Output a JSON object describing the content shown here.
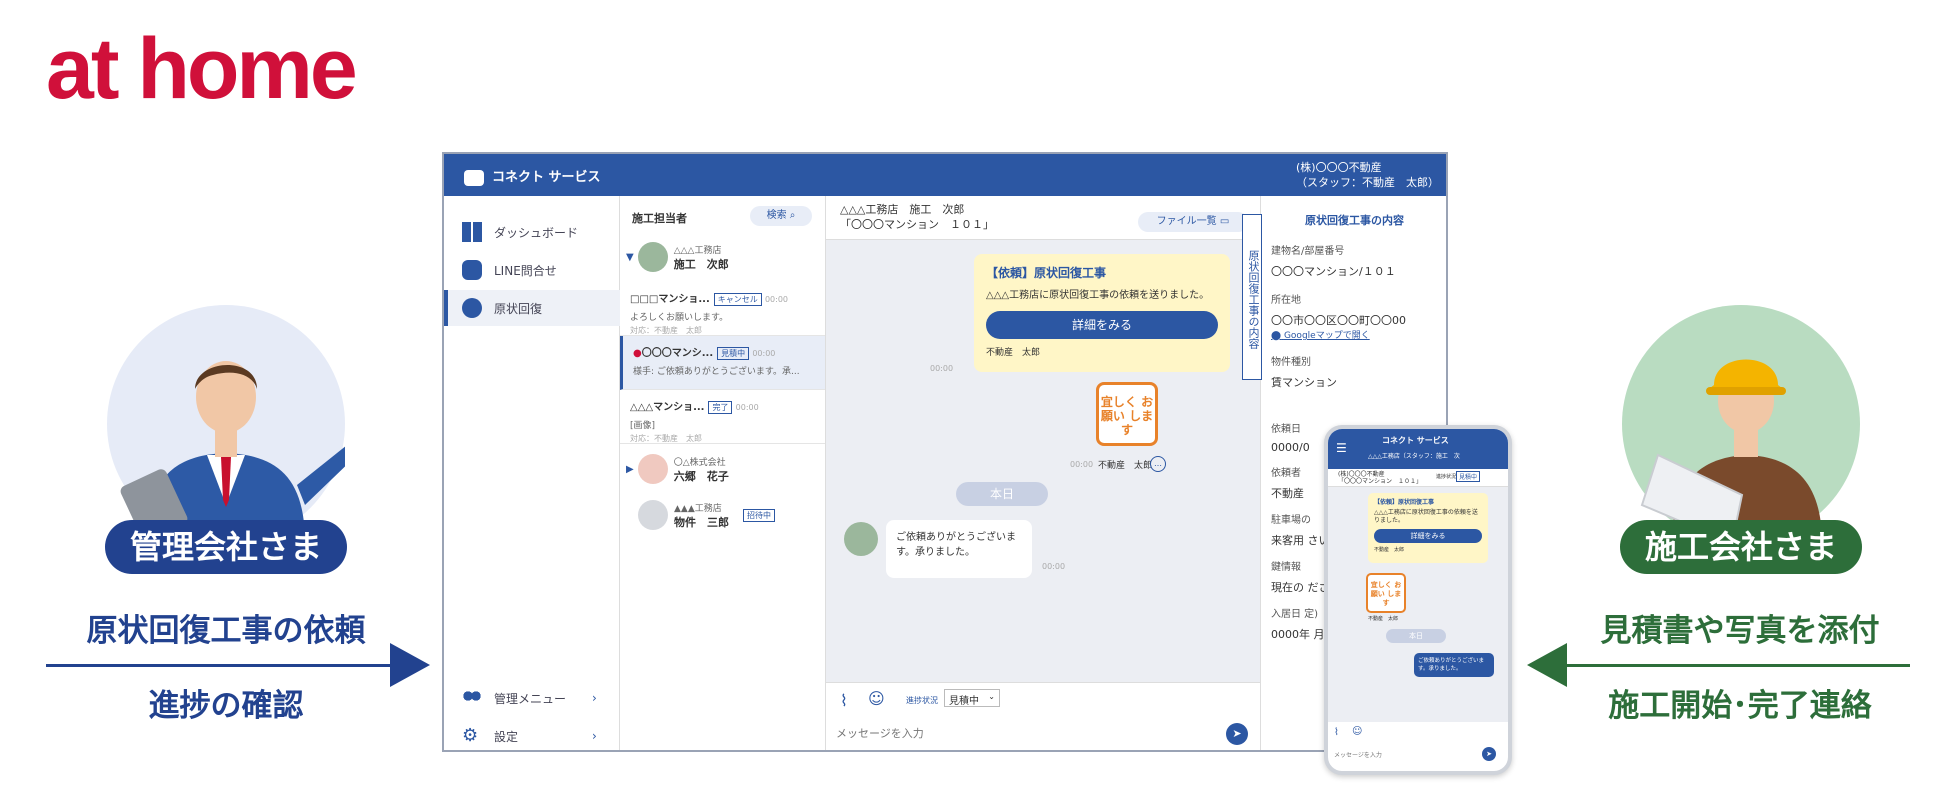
{
  "logo": {
    "text": "at home"
  },
  "left": {
    "badge": "管理会社さま",
    "caption1": "原状回復工事の依頼",
    "caption2": "進捗の確認"
  },
  "right": {
    "badge": "施工会社さま",
    "caption1": "見積書や写真を添付",
    "caption2": "施工開始･完了連絡"
  },
  "colors": {
    "brand": "#d0103a",
    "primary": "#2c57a3",
    "manager": "#22428f",
    "contractor": "#2d6e3a",
    "stamp": "#e8822a"
  },
  "app": {
    "title": "コネクト サービス",
    "user_line1": "(株)〇〇〇不動産",
    "user_line2": "（スタッフ：不動産　太郎）",
    "sidebar": {
      "items": [
        {
          "label": "ダッシュボード",
          "icon": "dashboard-icon"
        },
        {
          "label": "LINE問合せ",
          "icon": "chat-icon"
        },
        {
          "label": "原状回復",
          "icon": "restoration-icon"
        }
      ],
      "bottom": [
        {
          "label": "管理メニュー",
          "icon": "users-icon"
        },
        {
          "label": "設定",
          "icon": "gear-icon"
        }
      ]
    },
    "list": {
      "header": "施工担当者",
      "search_label": "検索",
      "groups": [
        {
          "company": "△△△工務店",
          "name": "施工　次郎"
        },
        {
          "company": "〇△株式会社",
          "name": "六郷　花子"
        },
        {
          "company": "▲▲▲工務店",
          "name": "物件　三郎",
          "badge": "招待中"
        }
      ],
      "conversations": [
        {
          "title": "□□□マンショ...",
          "badge": "キャンセル",
          "time": "00:00",
          "preview": "よろしくお願いします。",
          "meta": "対応：不動産　太郎"
        },
        {
          "title": "〇〇〇マンシ...",
          "badge": "見積中",
          "time": "00:00",
          "preview": "様手: ご依頼ありがとうございます。承...",
          "meta": ""
        },
        {
          "title": "△△△マンショ...",
          "badge": "完了",
          "time": "00:00",
          "preview": "[画像]",
          "meta": "対応：不動産　太郎"
        }
      ]
    },
    "chat": {
      "header_line1": "△△△工務店　施工　次郎",
      "header_line2": "「〇〇〇マンション　１０１」",
      "file_list_label": "ファイル一覧",
      "request_title": "【依頼】原状回復工事",
      "request_body": "△△△工務店に原状回復工事の依頼を送りました。",
      "detail_button": "詳細をみる",
      "request_sender": "不動産　太郎",
      "time": "00:00",
      "stamp_text": "宜しく お願い します",
      "stamp_sender": "不動産　太郎",
      "today_label": "本日",
      "reply_text": "ご依頼ありがとうございます。承りました。",
      "progress_label": "進捗状況",
      "progress_value": "見積中",
      "message_placeholder": "メッセージを入力"
    },
    "detail": {
      "tab_label": "原状回復工事の内容",
      "title": "原状回復工事の内容",
      "fields": [
        {
          "label": "建物名/部屋番号",
          "value": "〇〇〇マンション/１０１"
        },
        {
          "label": "所在地",
          "value": "〇〇市〇〇区〇〇町〇〇00"
        },
        {
          "label": "物件種別",
          "value": "賃マンション"
        },
        {
          "label": "依頼日",
          "value": "0000/0"
        },
        {
          "label": "依頼者",
          "value": "不動産"
        },
        {
          "label": "駐車場の",
          "value": "来客用 さい。"
        },
        {
          "label": "鍵情報",
          "value": "現在の ださい"
        },
        {
          "label": "入居日 定)",
          "value": "0000年 月00日 （入居"
        }
      ],
      "map_link": "Googleマップで開く"
    }
  },
  "phone": {
    "title": "コネクト サービス",
    "subtitle": "△△△工務店（スタッフ：施工　次",
    "chat_header1": "(株)〇〇〇不動産",
    "chat_header2": "「〇〇〇マンション　１０１」",
    "status_small": "進捗状況",
    "status_badge": "見積中",
    "request_title": "【依頼】原状回復工事",
    "request_body": "△△△工務店に原状回復工事の依頼を送りました。",
    "detail_button": "詳細をみる",
    "sender": "不動産　太郎",
    "stamp_text": "宜しく お願い します",
    "today_label": "本日",
    "reply_text": "ご依頼ありがとうございます。承りました。",
    "message_placeholder": "メッセージを入力"
  }
}
